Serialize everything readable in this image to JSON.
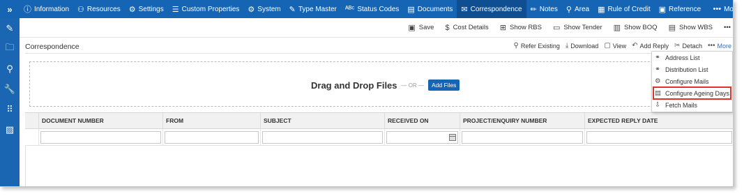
{
  "nav": {
    "expand": "»",
    "items": [
      {
        "label": "Information",
        "icon": "info-icon",
        "glyph": "ⓘ"
      },
      {
        "label": "Resources",
        "icon": "users-icon",
        "glyph": "⚇"
      },
      {
        "label": "Settings",
        "icon": "gears-icon",
        "glyph": "⚙"
      },
      {
        "label": "Custom Properties",
        "icon": "list-icon",
        "glyph": "☰"
      },
      {
        "label": "System",
        "icon": "system-icon",
        "glyph": "⚙"
      },
      {
        "label": "Type Master",
        "icon": "edit-icon",
        "glyph": "✎"
      },
      {
        "label": "Status Codes",
        "icon": "abc-icon",
        "glyph": "ᴬᴮᶜ"
      },
      {
        "label": "Documents",
        "icon": "documents-icon",
        "glyph": "▤"
      },
      {
        "label": "Correspondence",
        "icon": "mail-icon",
        "glyph": "✉",
        "active": true
      },
      {
        "label": "Notes",
        "icon": "pencil-icon",
        "glyph": "✏"
      },
      {
        "label": "Area",
        "icon": "map-pin-icon",
        "glyph": "⚲"
      },
      {
        "label": "Rule of Credit",
        "icon": "chart-icon",
        "glyph": "▦"
      },
      {
        "label": "Reference",
        "icon": "reference-icon",
        "glyph": "▣"
      }
    ],
    "more": "Mo"
  },
  "rail": [
    {
      "icon": "pencil-icon",
      "glyph": "✎"
    },
    {
      "icon": "folder-icon",
      "glyph": "🗀"
    },
    {
      "icon": "search-icon",
      "glyph": "⚲"
    },
    {
      "icon": "wrench-icon",
      "glyph": "🔧"
    },
    {
      "icon": "apps-grid-icon",
      "glyph": "⠿"
    },
    {
      "icon": "report-icon",
      "glyph": "▨"
    }
  ],
  "toolbar": {
    "save": "Save",
    "cost_details": "Cost Details",
    "show_rbs": "Show RBS",
    "show_tender": "Show Tender",
    "show_boq": "Show BOQ",
    "show_wbs": "Show WBS",
    "overflow": "•••"
  },
  "section": {
    "title": "Correspondence",
    "refer_existing": "Refer Existing",
    "download": "Download",
    "view": "View",
    "add_reply": "Add Reply",
    "detach": "Detach",
    "more": "More"
  },
  "dropzone": {
    "title": "Drag and Drop Files",
    "or": "— OR —",
    "add_files": "Add Files"
  },
  "grid": {
    "columns": [
      "",
      "DOCUMENT NUMBER",
      "FROM",
      "SUBJECT",
      "RECEIVED ON",
      "PROJECT/ENQUIRY NUMBER",
      "EXPECTED REPLY DATE"
    ]
  },
  "dropdown": {
    "items": [
      {
        "label": "Address List",
        "icon": "share-icon",
        "glyph": "⚭"
      },
      {
        "label": "Distribution List",
        "icon": "share-icon",
        "glyph": "⚭"
      },
      {
        "label": "Configure Mails",
        "icon": "gear-icon",
        "glyph": "⚙"
      },
      {
        "label": "Configure Ageing Days",
        "icon": "calendar-icon",
        "glyph": "▤",
        "highlighted": true
      },
      {
        "label": "Fetch Mails",
        "icon": "fetch-mail-icon",
        "glyph": "⇩"
      }
    ]
  },
  "colors": {
    "nav_bg": "#1565b4",
    "nav_active": "#0e4e91",
    "highlight_border": "#d9352a",
    "link": "#2b73c2"
  }
}
